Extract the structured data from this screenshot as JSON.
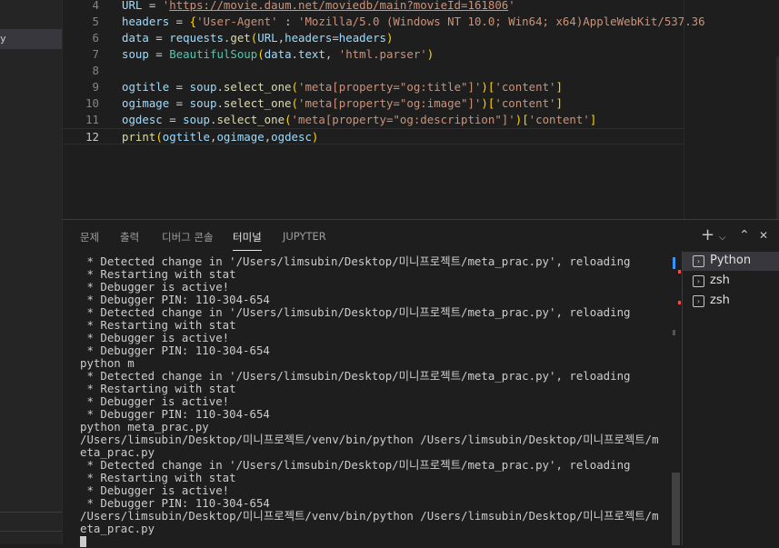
{
  "sidebar": {
    "selected_label": "y"
  },
  "editor": {
    "lines": [
      {
        "num": "4",
        "tokens": [
          [
            "v",
            "URL"
          ],
          [
            "p",
            " = "
          ],
          [
            "s",
            "'"
          ],
          [
            "su",
            "https://movie.daum.net/moviedb/main?movieId=161806"
          ],
          [
            "s",
            "'"
          ]
        ]
      },
      {
        "num": "5",
        "tokens": [
          [
            "v",
            "headers"
          ],
          [
            "p",
            " = "
          ],
          [
            "b1",
            "{"
          ],
          [
            "s",
            "'User-Agent'"
          ],
          [
            "p",
            " : "
          ],
          [
            "s",
            "'Mozilla/5.0 (Windows NT 10.0; Win64; x64)AppleWebKit/537.36"
          ]
        ]
      },
      {
        "num": "6",
        "tokens": [
          [
            "v",
            "data"
          ],
          [
            "p",
            " = "
          ],
          [
            "v",
            "requests"
          ],
          [
            "p",
            "."
          ],
          [
            "f",
            "get"
          ],
          [
            "b1",
            "("
          ],
          [
            "v",
            "URL"
          ],
          [
            "p",
            ","
          ],
          [
            "v",
            "headers"
          ],
          [
            "p",
            "="
          ],
          [
            "v",
            "headers"
          ],
          [
            "b1",
            ")"
          ]
        ]
      },
      {
        "num": "7",
        "tokens": [
          [
            "v",
            "soup"
          ],
          [
            "p",
            " = "
          ],
          [
            "cls",
            "BeautifulSoup"
          ],
          [
            "b1",
            "("
          ],
          [
            "v",
            "data"
          ],
          [
            "p",
            "."
          ],
          [
            "v",
            "text"
          ],
          [
            "p",
            ", "
          ],
          [
            "s",
            "'html.parser'"
          ],
          [
            "b1",
            ")"
          ]
        ]
      },
      {
        "num": "8",
        "tokens": []
      },
      {
        "num": "9",
        "tokens": [
          [
            "v",
            "ogtitle"
          ],
          [
            "p",
            " = "
          ],
          [
            "v",
            "soup"
          ],
          [
            "p",
            "."
          ],
          [
            "f",
            "select_one"
          ],
          [
            "b1",
            "("
          ],
          [
            "s",
            "'meta[property=\"og:title\"]'"
          ],
          [
            "b1",
            ")"
          ],
          [
            "b1",
            "["
          ],
          [
            "s",
            "'content'"
          ],
          [
            "b1",
            "]"
          ]
        ]
      },
      {
        "num": "10",
        "tokens": [
          [
            "v",
            "ogimage"
          ],
          [
            "p",
            " = "
          ],
          [
            "v",
            "soup"
          ],
          [
            "p",
            "."
          ],
          [
            "f",
            "select_one"
          ],
          [
            "b1",
            "("
          ],
          [
            "s",
            "'meta[property=\"og:image\"]'"
          ],
          [
            "b1",
            ")"
          ],
          [
            "b1",
            "["
          ],
          [
            "s",
            "'content'"
          ],
          [
            "b1",
            "]"
          ]
        ]
      },
      {
        "num": "11",
        "tokens": [
          [
            "v",
            "ogdesc"
          ],
          [
            "p",
            " = "
          ],
          [
            "v",
            "soup"
          ],
          [
            "p",
            "."
          ],
          [
            "f",
            "select_one"
          ],
          [
            "b1",
            "("
          ],
          [
            "s",
            "'meta[property=\"og:description\"]'"
          ],
          [
            "b1",
            ")"
          ],
          [
            "b1",
            "["
          ],
          [
            "s",
            "'content'"
          ],
          [
            "b1",
            "]"
          ]
        ]
      },
      {
        "num": "12",
        "tokens": [
          [
            "f",
            "print"
          ],
          [
            "b1",
            "("
          ],
          [
            "v",
            "ogtitle"
          ],
          [
            "p",
            ","
          ],
          [
            "v",
            "ogimage"
          ],
          [
            "p",
            ","
          ],
          [
            "v",
            "ogdesc"
          ],
          [
            "b1",
            ")"
          ]
        ]
      }
    ]
  },
  "panel": {
    "tabs": [
      {
        "label": "문제",
        "active": false
      },
      {
        "label": "출력",
        "active": false
      },
      {
        "label": "디버그 콘솔",
        "active": false
      },
      {
        "label": "터미널",
        "active": true
      },
      {
        "label": "JUPYTER",
        "active": false
      }
    ],
    "controls": {
      "add": "+",
      "dropdown": "⌵",
      "maximize": "⌃",
      "close": "✕"
    },
    "terminal_lines": [
      " * Detected change in '/Users/limsubin/Desktop/미니프로젝트/meta_prac.py', reloading",
      " * Restarting with stat",
      " * Debugger is active!",
      " * Debugger PIN: 110-304-654",
      " * Detected change in '/Users/limsubin/Desktop/미니프로젝트/meta_prac.py', reloading",
      " * Restarting with stat",
      " * Debugger is active!",
      " * Debugger PIN: 110-304-654",
      "python m",
      " * Detected change in '/Users/limsubin/Desktop/미니프로젝트/meta_prac.py', reloading",
      " * Restarting with stat",
      " * Debugger is active!",
      " * Debugger PIN: 110-304-654",
      "python meta_prac.py",
      "/Users/limsubin/Desktop/미니프로젝트/venv/bin/python /Users/limsubin/Desktop/미니프로젝트/m",
      "eta_prac.py",
      " * Detected change in '/Users/limsubin/Desktop/미니프로젝트/meta_prac.py', reloading",
      " * Restarting with stat",
      " * Debugger is active!",
      " * Debugger PIN: 110-304-654",
      "/Users/limsubin/Desktop/미니프로젝트/venv/bin/python /Users/limsubin/Desktop/미니프로젝트/m",
      "eta_prac.py"
    ],
    "instances": [
      {
        "name": "Python",
        "selected": true
      },
      {
        "name": "zsh",
        "selected": false
      },
      {
        "name": "zsh",
        "selected": false
      }
    ]
  },
  "colors": {
    "string": "#ce9178",
    "variable": "#9cdcfe",
    "function": "#dcdcaa",
    "class": "#4ec9b0",
    "bracket": "#ffd700",
    "marker_blue": "#3794ff",
    "marker_red": "#f14c4c"
  }
}
